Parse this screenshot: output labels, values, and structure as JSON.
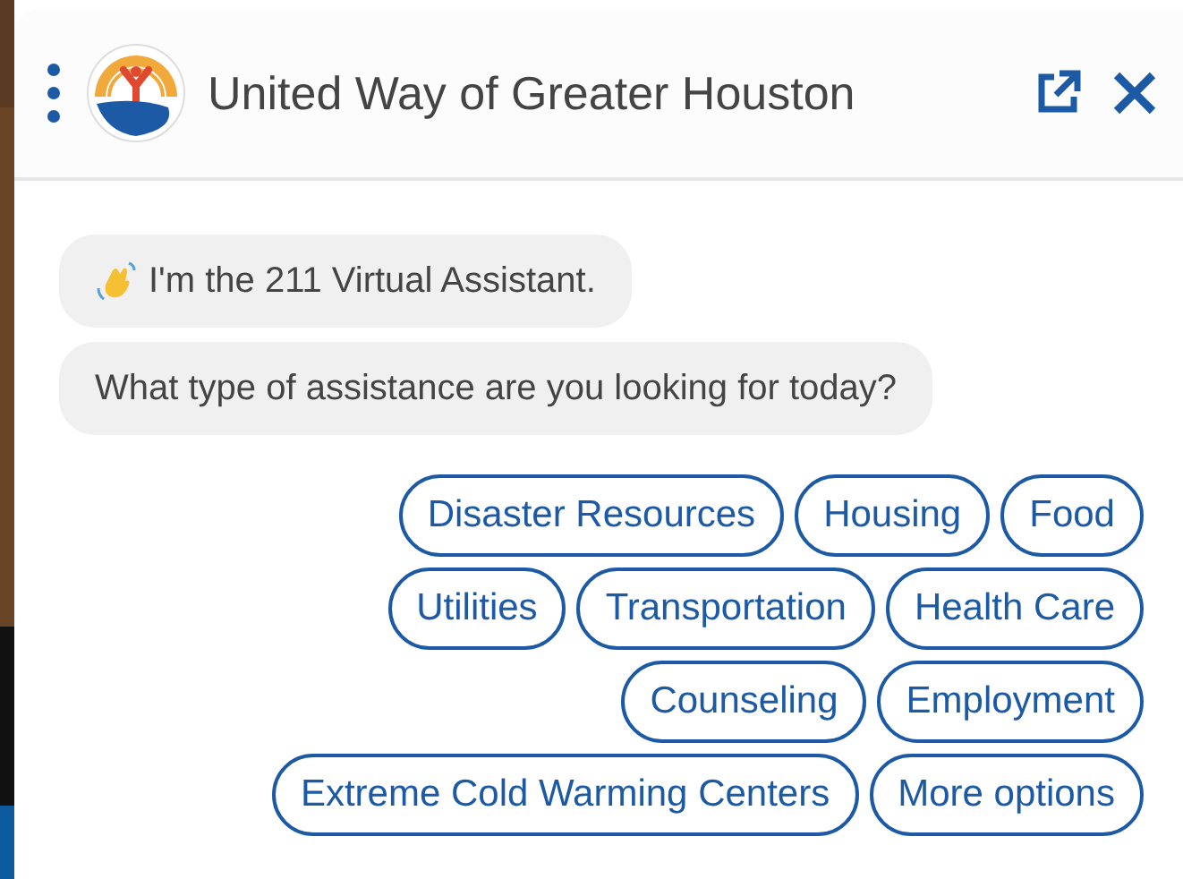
{
  "header": {
    "title": "United Way of Greater Houston"
  },
  "messages": [
    {
      "text": "I'm the 211 Virtual Assistant.",
      "kind": "wave"
    },
    {
      "text": "What type of assistance are you looking for today?",
      "kind": "plain"
    }
  ],
  "quick_replies": [
    [
      "Disaster Resources",
      "Housing",
      "Food"
    ],
    [
      "Utilities",
      "Transportation",
      "Health Care"
    ],
    [
      "Counseling",
      "Employment"
    ],
    [
      "Extreme Cold Warming Centers",
      "More options"
    ]
  ]
}
